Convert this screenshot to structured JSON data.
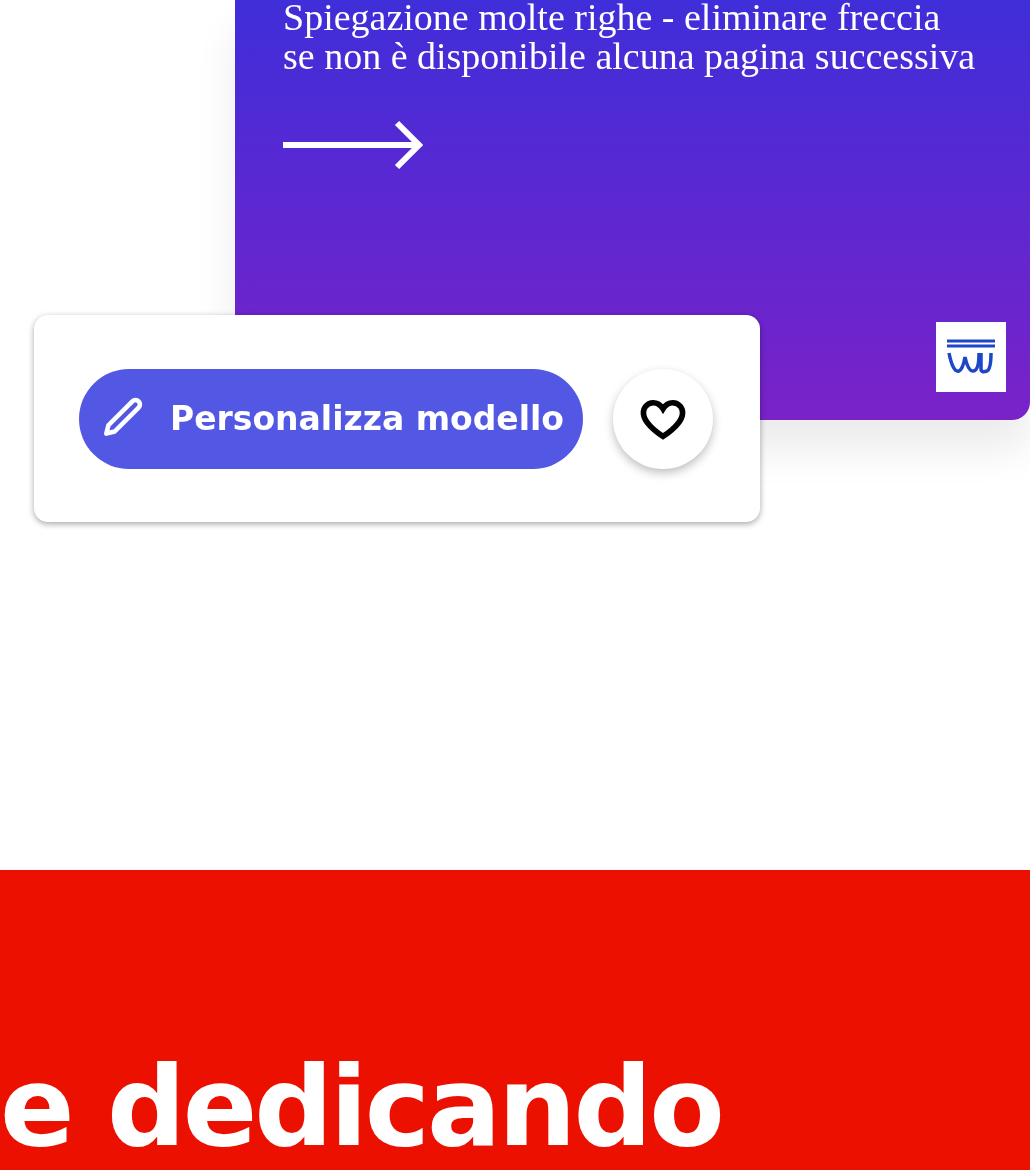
{
  "promo_card": {
    "description_lines": [
      "Spiegazione molte righe - eliminare freccia",
      "se non è disponibile alcuna pagina successiva"
    ],
    "has_next_arrow": true
  },
  "actions": {
    "customize_button": "Personalizza modello",
    "favorite": {
      "selected": false
    }
  },
  "banner": {
    "heading": "e dedicando"
  }
}
